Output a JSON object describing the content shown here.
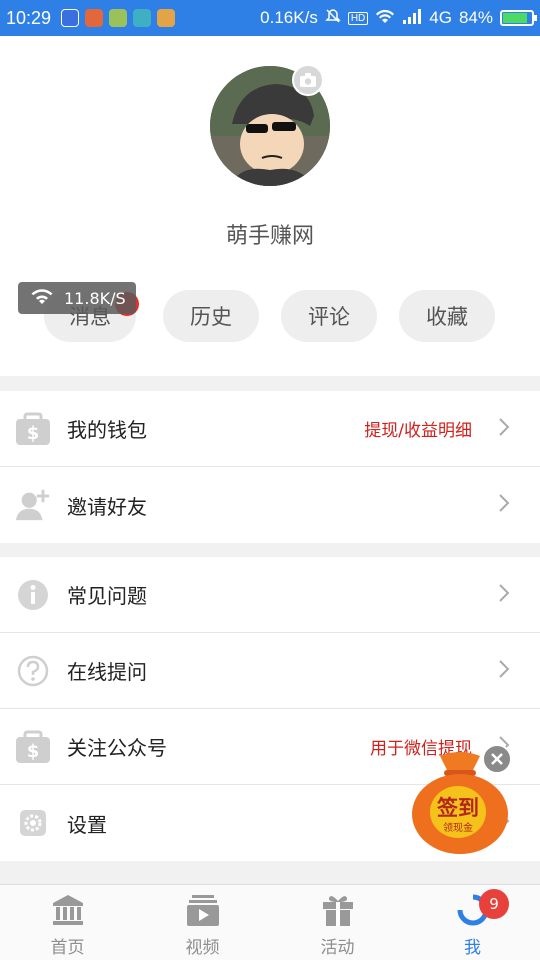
{
  "status_bar": {
    "time": "10:29",
    "speed": "0.16K/s",
    "network": "4G",
    "battery": "84%",
    "battery_level": 0.84
  },
  "profile": {
    "nickname": "萌手赚网",
    "speed_toast": "11.8K/S",
    "tabs": [
      {
        "label": "消息",
        "has_badge": true
      },
      {
        "label": "历史"
      },
      {
        "label": "评论"
      },
      {
        "label": "收藏"
      }
    ]
  },
  "menu": {
    "group1": [
      {
        "label": "我的钱包",
        "extra": "提现/收益明细",
        "icon": "wallet-icon"
      },
      {
        "label": "邀请好友",
        "extra": "",
        "icon": "add-friend-icon"
      }
    ],
    "group2": [
      {
        "label": "常见问题",
        "extra": "",
        "icon": "info-icon"
      },
      {
        "label": "在线提问",
        "extra": "",
        "icon": "question-icon"
      },
      {
        "label": "关注公众号",
        "extra": "用于微信提现",
        "icon": "wallet-icon"
      },
      {
        "label": "设置",
        "extra": "",
        "icon": "gear-icon"
      }
    ]
  },
  "signin": {
    "title": "签到",
    "subtitle": "领现金"
  },
  "bottom_nav": {
    "items": [
      {
        "label": "首页",
        "icon": "home-icon"
      },
      {
        "label": "视频",
        "icon": "video-icon"
      },
      {
        "label": "活动",
        "icon": "gift-icon"
      },
      {
        "label": "我",
        "icon": "profile-icon",
        "badge": "9",
        "active": true
      }
    ]
  },
  "colors": {
    "accent": "#2e7fe6",
    "highlight_text": "#d0211b",
    "badge": "#e0312d"
  }
}
